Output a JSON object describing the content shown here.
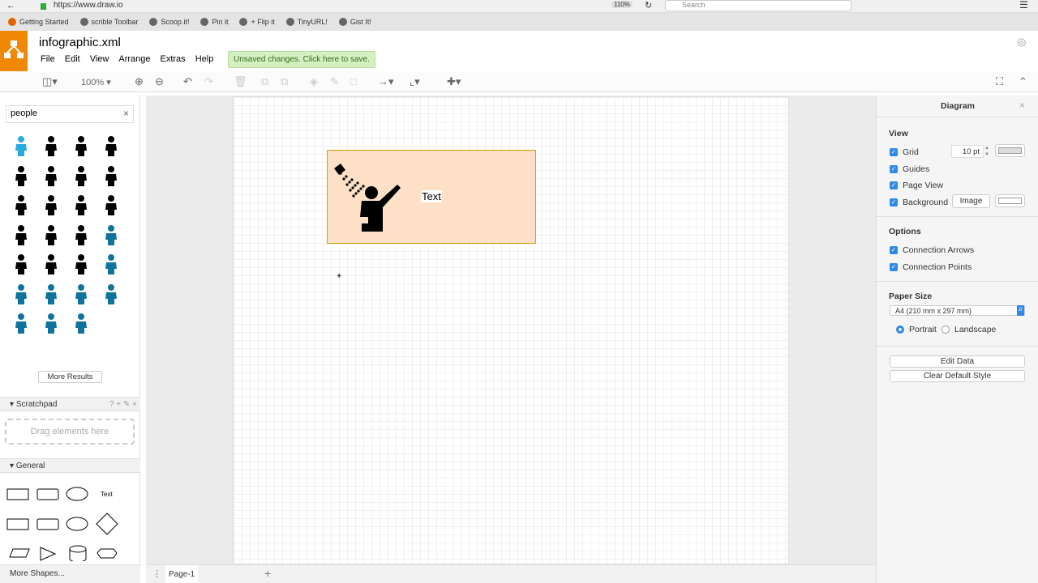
{
  "browser": {
    "url": "https://www.draw.io",
    "zoom": "110%",
    "search_placeholder": "Search",
    "bookmarks": [
      "Getting Started",
      "scrible Toolbar",
      "Scoop.it!",
      "Pin it",
      "+ Flip it",
      "TinyURL!",
      "Gist It!"
    ]
  },
  "app": {
    "title": "infographic.xml",
    "menu": [
      "File",
      "Edit",
      "View",
      "Arrange",
      "Extras",
      "Help"
    ],
    "unsaved": "Unsaved changes. Click here to save.",
    "accent": "#f08705"
  },
  "toolbar": {
    "zoom": "100%"
  },
  "sidebar": {
    "search_value": "people",
    "more_results": "More Results",
    "scratchpad": "Scratchpad",
    "drag_hint": "Drag elements here",
    "general": "General",
    "general_text_shape": "Text",
    "more_shapes": "More Shapes...",
    "shape_count": 27
  },
  "canvas": {
    "card_text": "Text",
    "card_fill": "#fde0c6",
    "card_stroke": "#d79b00"
  },
  "pages": {
    "tab": "Page-1"
  },
  "panel": {
    "title": "Diagram",
    "view": "View",
    "grid": "Grid",
    "grid_size": "10 pt",
    "guides": "Guides",
    "page_view": "Page View",
    "background": "Background",
    "image": "Image",
    "options": "Options",
    "connection_arrows": "Connection Arrows",
    "connection_points": "Connection Points",
    "paper_size": "Paper Size",
    "paper_value": "A4 (210 mm x 297 mm)",
    "portrait": "Portrait",
    "landscape": "Landscape",
    "edit_data": "Edit Data",
    "clear_style": "Clear Default Style"
  }
}
